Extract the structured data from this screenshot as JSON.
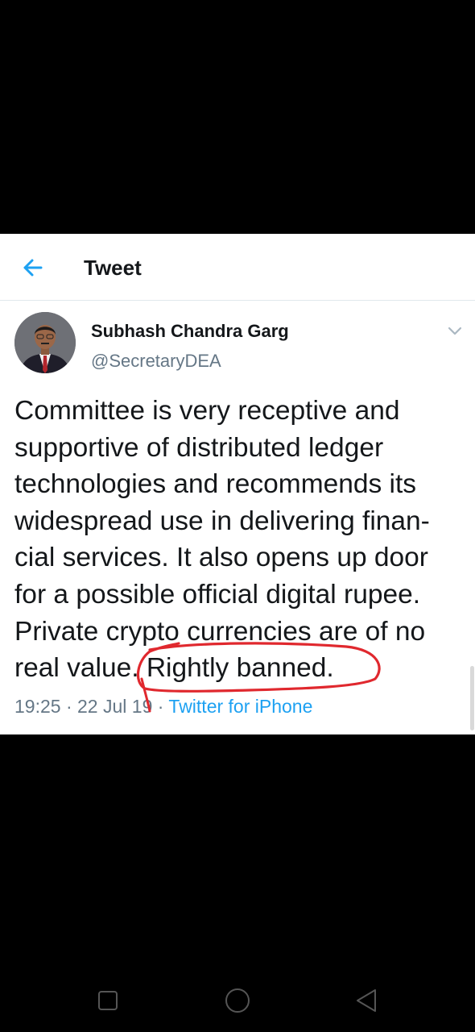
{
  "header": {
    "title": "Tweet",
    "back_icon": "arrow-left-icon",
    "accent_color": "#1da1f2"
  },
  "tweet": {
    "author": {
      "name": "Subhash Chandra Garg",
      "handle": "@SecretaryDEA"
    },
    "menu_icon": "chevron-down-icon",
    "text_lines": [
      "Committee is very receptive and",
      "supportive of distributed ledger",
      "technologies and recommends its",
      "widespread use in delivering finan-",
      "cial services. It also opens up door",
      "for a possible official digital rupee.",
      "Private crypto currencies are of no",
      "real value. Rightly banned."
    ],
    "time": "19:25",
    "date": "22 Jul 19",
    "separator": "·",
    "source": "Twitter for iPhone"
  },
  "annotation": {
    "color": "#e0282e",
    "circled_text": "Rightly banned."
  },
  "navbar": {
    "icons": [
      "square-recents-icon",
      "circle-home-icon",
      "triangle-back-icon"
    ]
  }
}
